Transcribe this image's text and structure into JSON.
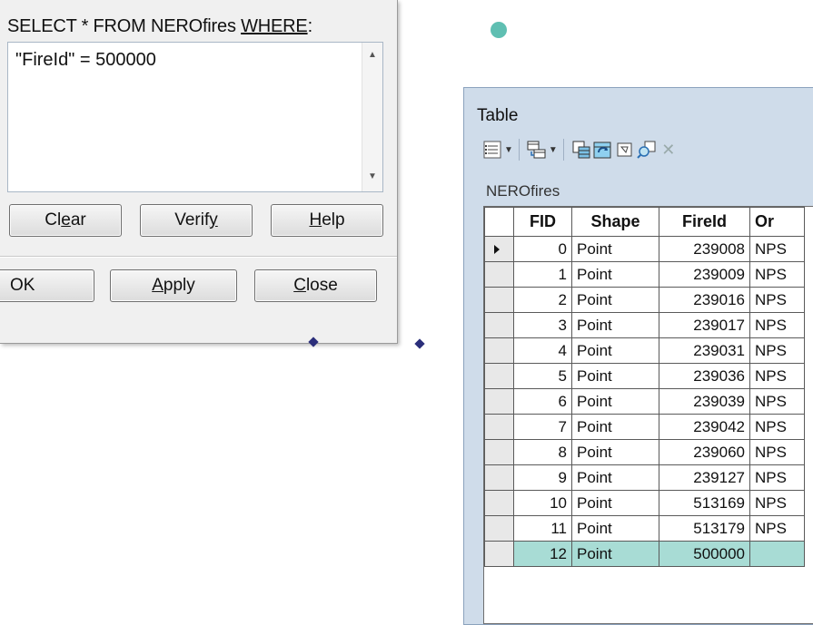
{
  "dialog": {
    "sql_prefix": "SELECT * FROM NEROfires ",
    "sql_where": "WHERE",
    "sql_suffix": ":",
    "expression": "\"FireId\" = 500000",
    "buttons": {
      "clear": {
        "before": "Cl",
        "underline": "e",
        "after": "ar"
      },
      "verify": {
        "before": "Verif",
        "underline": "y",
        "after": ""
      },
      "help": {
        "before": "",
        "underline": "H",
        "after": "elp"
      },
      "ok": "OK",
      "apply": {
        "before": "",
        "underline": "A",
        "after": "pply"
      },
      "close": {
        "before": "",
        "underline": "C",
        "after": "lose"
      }
    }
  },
  "table_window": {
    "title": "Table",
    "tab": "NEROfires",
    "columns": [
      "FID",
      "Shape",
      "FireId",
      "Or"
    ],
    "rows": [
      {
        "fid": "0",
        "shape": "Point",
        "fireid": "239008",
        "org": "NPS",
        "current": true
      },
      {
        "fid": "1",
        "shape": "Point",
        "fireid": "239009",
        "org": "NPS"
      },
      {
        "fid": "2",
        "shape": "Point",
        "fireid": "239016",
        "org": "NPS"
      },
      {
        "fid": "3",
        "shape": "Point",
        "fireid": "239017",
        "org": "NPS"
      },
      {
        "fid": "4",
        "shape": "Point",
        "fireid": "239031",
        "org": "NPS"
      },
      {
        "fid": "5",
        "shape": "Point",
        "fireid": "239036",
        "org": "NPS"
      },
      {
        "fid": "6",
        "shape": "Point",
        "fireid": "239039",
        "org": "NPS"
      },
      {
        "fid": "7",
        "shape": "Point",
        "fireid": "239042",
        "org": "NPS"
      },
      {
        "fid": "8",
        "shape": "Point",
        "fireid": "239060",
        "org": "NPS"
      },
      {
        "fid": "9",
        "shape": "Point",
        "fireid": "239127",
        "org": "NPS"
      },
      {
        "fid": "10",
        "shape": "Point",
        "fireid": "513169",
        "org": "NPS"
      },
      {
        "fid": "11",
        "shape": "Point",
        "fireid": "513179",
        "org": "NPS"
      },
      {
        "fid": "12",
        "shape": "Point",
        "fireid": "500000",
        "org": "",
        "highlighted": true
      }
    ]
  },
  "colors": {
    "selection_highlight": "#a8dcd5",
    "selected_point": "#5fbfb2",
    "map_point": "#2b2e7a"
  }
}
